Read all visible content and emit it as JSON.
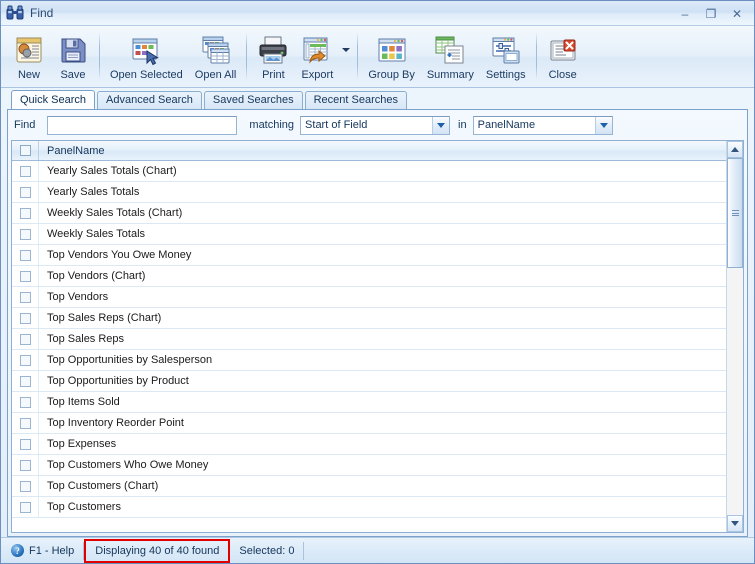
{
  "window": {
    "title": "Find",
    "title_icon": "binoculars-icon",
    "controls": {
      "minimize": "–",
      "maximize": "❐",
      "close": "✕"
    }
  },
  "toolbar": {
    "buttons": [
      {
        "label": "New",
        "icon": "new-document-icon"
      },
      {
        "label": "Save",
        "icon": "floppy-disk-icon"
      },
      {
        "label": "Open Selected",
        "icon": "open-selected-icon"
      },
      {
        "label": "Open All",
        "icon": "open-all-icon"
      },
      {
        "label": "Print",
        "icon": "printer-icon"
      },
      {
        "label": "Export",
        "icon": "export-icon"
      },
      {
        "label": "Group By",
        "icon": "group-by-icon"
      },
      {
        "label": "Summary",
        "icon": "summary-icon"
      },
      {
        "label": "Settings",
        "icon": "settings-icon"
      },
      {
        "label": "Close",
        "icon": "close-document-icon"
      }
    ]
  },
  "tabs": [
    {
      "label": "Quick Search",
      "active": true
    },
    {
      "label": "Advanced Search",
      "active": false
    },
    {
      "label": "Saved Searches",
      "active": false
    },
    {
      "label": "Recent Searches",
      "active": false
    }
  ],
  "search": {
    "find_label": "Find",
    "find_value": "",
    "find_placeholder": "",
    "matching_label": "matching",
    "matching_value": "Start of Field",
    "in_label": "in",
    "in_value": "PanelName"
  },
  "list": {
    "header": {
      "column_name": "PanelName"
    },
    "rows": [
      {
        "name": "Yearly Sales Totals (Chart)",
        "checked": false
      },
      {
        "name": "Yearly Sales Totals",
        "checked": false
      },
      {
        "name": "Weekly Sales Totals (Chart)",
        "checked": false
      },
      {
        "name": "Weekly Sales Totals",
        "checked": false
      },
      {
        "name": "Top Vendors You Owe Money",
        "checked": false
      },
      {
        "name": "Top Vendors (Chart)",
        "checked": false
      },
      {
        "name": "Top Vendors",
        "checked": false
      },
      {
        "name": "Top Sales Reps (Chart)",
        "checked": false
      },
      {
        "name": "Top Sales Reps",
        "checked": false
      },
      {
        "name": "Top Opportunities by Salesperson",
        "checked": false
      },
      {
        "name": "Top Opportunities by Product",
        "checked": false
      },
      {
        "name": "Top Items Sold",
        "checked": false
      },
      {
        "name": "Top Inventory Reorder Point",
        "checked": false
      },
      {
        "name": "Top Expenses",
        "checked": false
      },
      {
        "name": "Top Customers Who Owe Money",
        "checked": false
      },
      {
        "name": "Top Customers (Chart)",
        "checked": false
      },
      {
        "name": "Top Customers",
        "checked": false
      }
    ]
  },
  "statusbar": {
    "help": "F1 - Help",
    "displaying": "Displaying 40 of 40 found",
    "selected": "Selected: 0",
    "highlight_color": "#e00000"
  }
}
